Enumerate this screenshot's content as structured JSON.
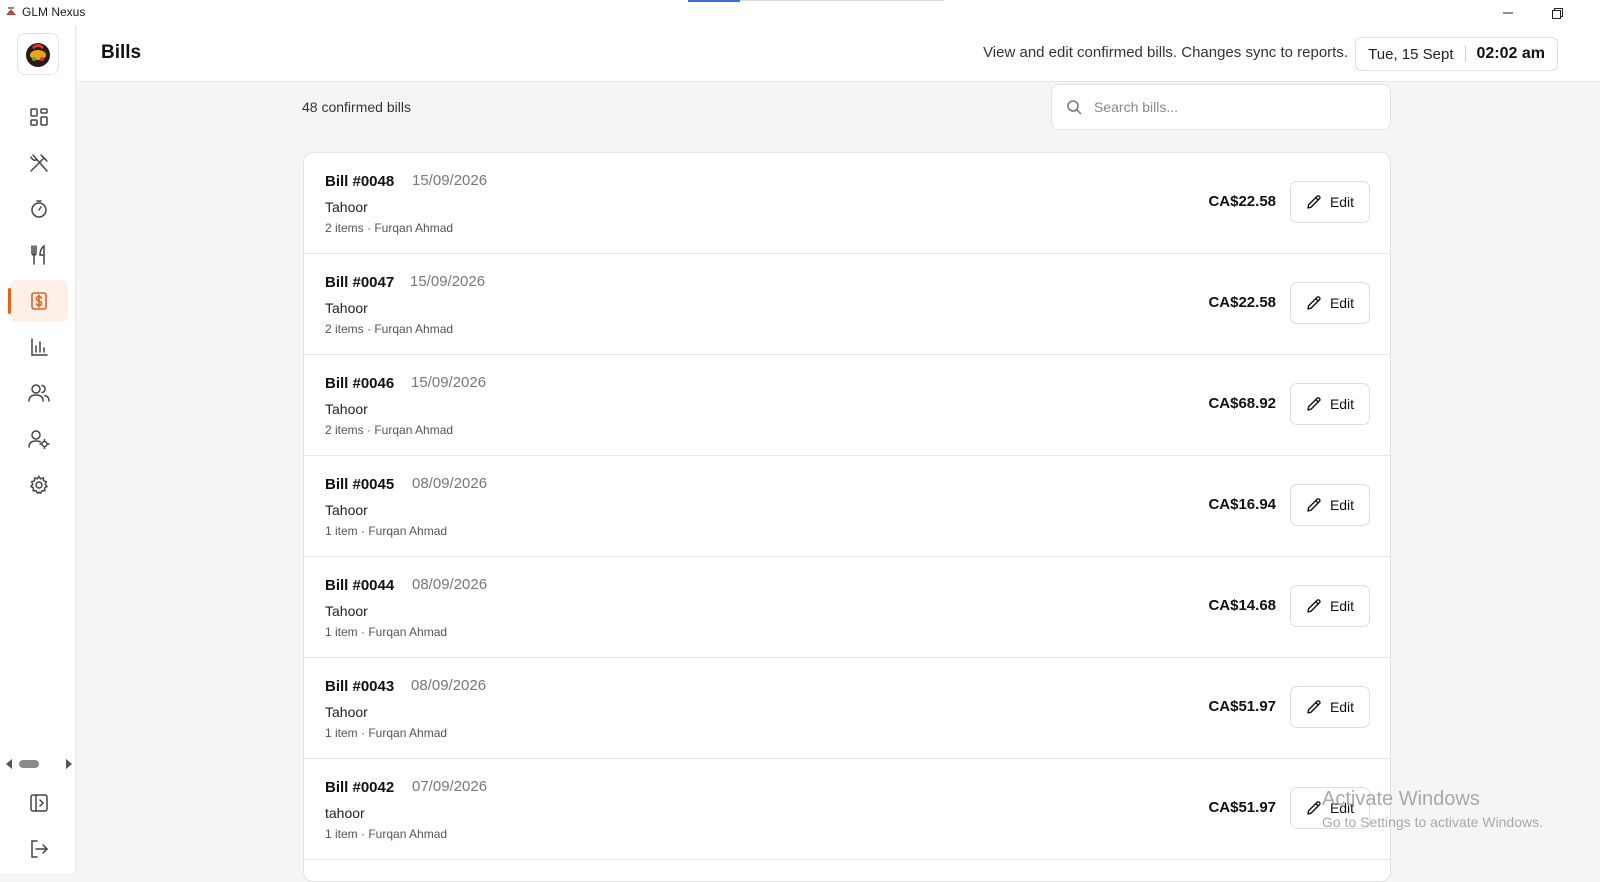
{
  "window": {
    "title": "GLM Nexus"
  },
  "header": {
    "title": "Bills",
    "description": "View and edit confirmed bills. Changes sync to reports.",
    "date": "Tue, 15 Sept",
    "time": "02:02 am"
  },
  "toolbar": {
    "count_label": "48 confirmed bills",
    "search_placeholder": "Search bills..."
  },
  "sidebar": {
    "items": [
      {
        "icon": "dashboard-icon"
      },
      {
        "icon": "utensils-crossed-icon"
      },
      {
        "icon": "timer-icon"
      },
      {
        "icon": "fork-knife-icon"
      },
      {
        "icon": "bill-dollar-icon",
        "active": true
      },
      {
        "icon": "bar-chart-icon"
      },
      {
        "icon": "users-icon"
      },
      {
        "icon": "user-settings-icon"
      },
      {
        "icon": "gear-icon"
      }
    ],
    "bottom": [
      {
        "icon": "collapse-sidebar-icon"
      },
      {
        "icon": "logout-icon"
      }
    ]
  },
  "colors": {
    "accent": "#e8601c",
    "accent_bg": "#fdf0e8",
    "border": "#e3e3e3"
  },
  "bills": [
    {
      "number": "Bill #0048",
      "date": "15/09/2026",
      "customer": "Tahoor",
      "meta": "2 items · Furqan Ahmad",
      "amount": "CA$22.58",
      "edit_label": "Edit"
    },
    {
      "number": "Bill #0047",
      "date": "15/09/2026",
      "customer": "Tahoor",
      "meta": "2 items · Furqan Ahmad",
      "amount": "CA$22.58",
      "edit_label": "Edit"
    },
    {
      "number": "Bill #0046",
      "date": "15/09/2026",
      "customer": "Tahoor",
      "meta": "2 items · Furqan Ahmad",
      "amount": "CA$68.92",
      "edit_label": "Edit"
    },
    {
      "number": "Bill #0045",
      "date": "08/09/2026",
      "customer": "Tahoor",
      "meta": "1 item · Furqan Ahmad",
      "amount": "CA$16.94",
      "edit_label": "Edit"
    },
    {
      "number": "Bill #0044",
      "date": "08/09/2026",
      "customer": "Tahoor",
      "meta": "1 item · Furqan Ahmad",
      "amount": "CA$14.68",
      "edit_label": "Edit"
    },
    {
      "number": "Bill #0043",
      "date": "08/09/2026",
      "customer": "Tahoor",
      "meta": "1 item · Furqan Ahmad",
      "amount": "CA$51.97",
      "edit_label": "Edit"
    },
    {
      "number": "Bill #0042",
      "date": "07/09/2026",
      "customer": "tahoor",
      "meta": "1 item · Furqan Ahmad",
      "amount": "CA$51.97",
      "edit_label": "Edit"
    }
  ],
  "watermark": {
    "line1": "Activate Windows",
    "line2": "Go to Settings to activate Windows."
  }
}
